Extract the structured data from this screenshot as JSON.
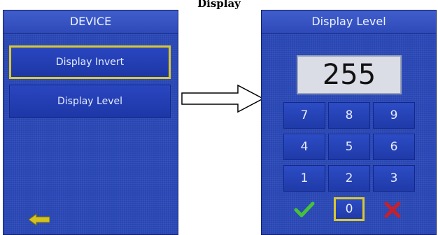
{
  "caption": "Display",
  "left_screen": {
    "title": "DEVICE",
    "menu": [
      {
        "label": "Display Invert",
        "selected": true
      },
      {
        "label": "Display Level",
        "selected": false
      }
    ],
    "back_icon": "back-arrow-icon"
  },
  "right_screen": {
    "title": "Display Level",
    "value": "255",
    "keys": {
      "k7": "7",
      "k8": "8",
      "k9": "9",
      "k4": "4",
      "k5": "5",
      "k6": "6",
      "k1": "1",
      "k2": "2",
      "k3": "3",
      "k0": "0"
    },
    "confirm_icon": "checkmark-icon",
    "cancel_icon": "x-cross-icon"
  },
  "transition_icon": "right-arrow-icon",
  "colors": {
    "screen_bg": "#2846b3",
    "highlight": "#d9c832",
    "confirm": "#46c13a",
    "cancel": "#c8202a",
    "back_arrow": "#d4c21e"
  }
}
